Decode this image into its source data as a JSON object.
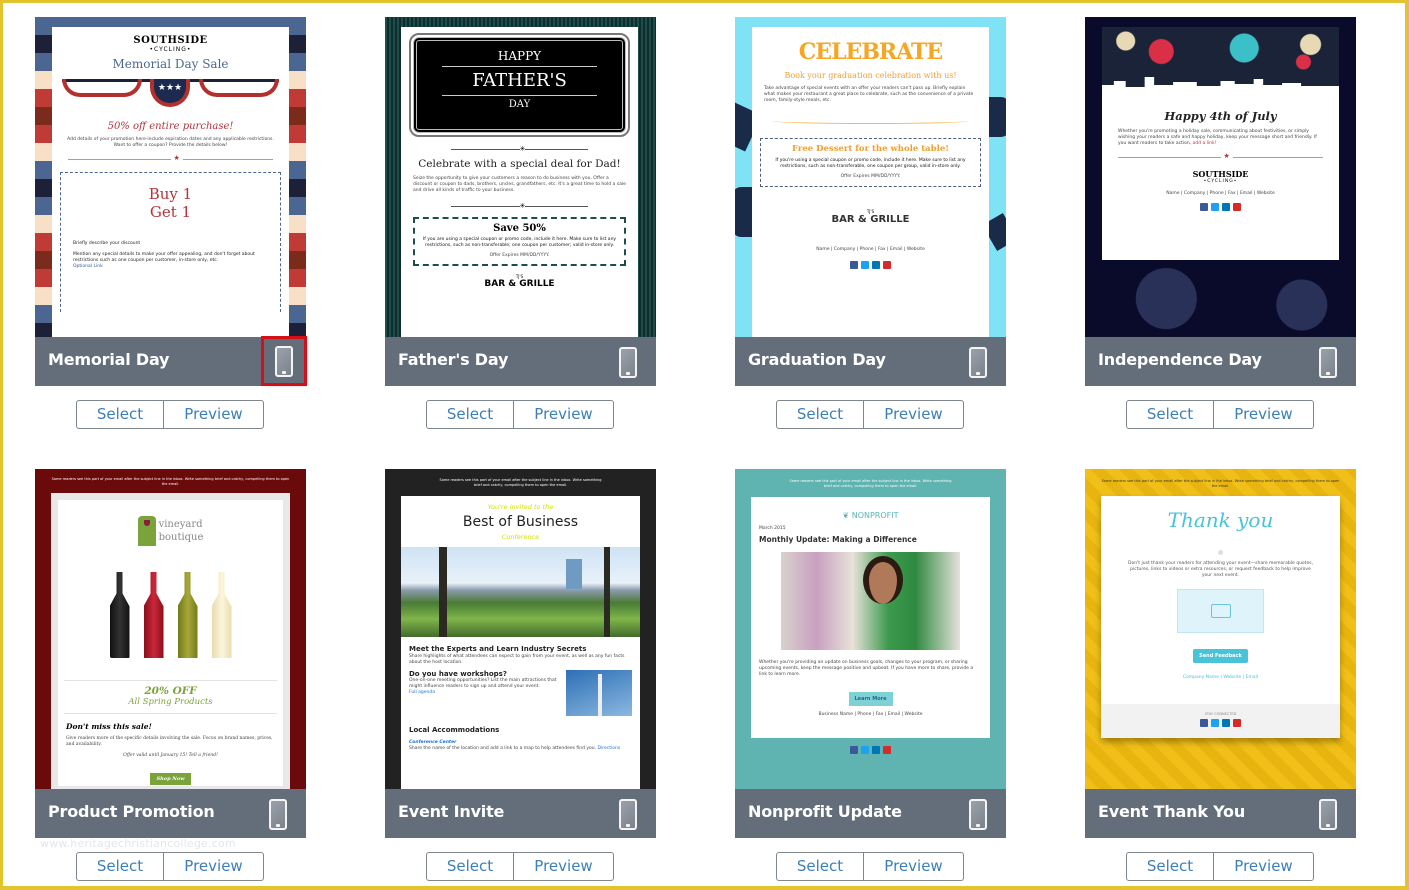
{
  "accent_colors": {
    "frame": "#e2c52e",
    "caption_bg": "#646e7a",
    "button_text": "#3d7fb9",
    "highlight": "#d40f17"
  },
  "templates": [
    {
      "title": "Memorial Day",
      "select_label": "Select",
      "preview_label": "Preview",
      "mobile_icon": "mobile-phone-icon",
      "mobile_highlighted": true,
      "preview": {
        "brand": "SOUTHSIDE",
        "brand_sub": "•CYCLING•",
        "heading": "Memorial Day Sale",
        "offer": "50% off entire purchase!",
        "body": "Add details of your promotion here-include expiration dates and any applicable restrictions. Want to offer a coupon? Provide the details below!",
        "coupon_line1": "Buy 1",
        "coupon_line2": "Get 1",
        "coupon_desc": "Briefly describe your discount",
        "coupon_body": "Mention any special details to make your offer appealing, and don't forget about restrictions such as one coupon per customer, in-store only, etc.",
        "coupon_link": "Optional Link"
      }
    },
    {
      "title": "Father's Day",
      "select_label": "Select",
      "preview_label": "Preview",
      "mobile_icon": "mobile-phone-icon",
      "mobile_highlighted": false,
      "preview": {
        "banner1": "HAPPY",
        "banner2": "FATHER'S",
        "banner3": "DAY",
        "heading": "Celebrate with a special deal for Dad!",
        "body": "Seize the opportunity to give your customers a reason to do business with you. Offer a discount or coupon to dads, brothers, uncles, grandfathers, etc. It's a great time to hold a sale and drive all kinds of traffic to your business.",
        "coupon_title": "Save 50%",
        "coupon_body": "If you are using a special coupon or promo code, include it here. Make sure to list any restrictions, such as non-transferable; one coupon per customer; valid in-store only.",
        "expires": "Offer Expires MM/DD/YYYY.",
        "logo": "BAR & GRILLE",
        "logo_top": "TJ'S"
      }
    },
    {
      "title": "Graduation Day",
      "select_label": "Select",
      "preview_label": "Preview",
      "mobile_icon": "mobile-phone-icon",
      "mobile_highlighted": false,
      "preview": {
        "banner": "CELEBRATE",
        "heading": "Book your graduation celebration with us!",
        "body": "Take advantage of special events with an offer your readers can't pass up. Briefly explain what makes your restaurant a great place to celebrate, such as the convenience of a private room, family-style meals, etc.",
        "coupon_title": "Free Dessert for the whole table!",
        "coupon_body": "If you're using a special coupon or promo code, include it here. Make sure to list any restrictions, such as non-transferable, one coupon per group, valid in-store only.",
        "expires": "Offer Expires MM/DD/YYYY.",
        "logo": "BAR & GRILLE",
        "logo_top": "TJ'S",
        "footer": "Name | Company | Phone | Fax | Email | Website"
      }
    },
    {
      "title": "Independence Day",
      "select_label": "Select",
      "preview_label": "Preview",
      "mobile_icon": "mobile-phone-icon",
      "mobile_highlighted": false,
      "preview": {
        "heading": "Happy 4th of July",
        "body": "Whether you're promoting a holiday sale, communicating about festivities, or simply wishing your readers a safe and happy holiday, keep your message short and friendly. If you want readers to take action,",
        "link": "add a link!",
        "brand": "SOUTHSIDE",
        "brand_sub": "•CYCLING•",
        "footer": "Name | Company | Phone | Fax | Email | Website"
      }
    },
    {
      "title": "Product Promotion",
      "select_label": "Select",
      "preview_label": "Preview",
      "mobile_icon": "mobile-phone-icon",
      "mobile_highlighted": false,
      "preview": {
        "preheader": "Some readers see this part of your email after the subject line in the inbox. Write something brief and catchy, compelling them to open the email.",
        "brand1": "vineyard",
        "brand2": "boutique",
        "offer": "20% OFF",
        "offer_sub": "All Spring Products",
        "heading": "Don't miss this sale!",
        "body": "Give readers more of the specific details involving the sale. Focus on brand names, prices, and availability.",
        "note": "Offer valid until January 15! Tell a friend!",
        "cta": "Shop Now"
      }
    },
    {
      "title": "Event Invite",
      "select_label": "Select",
      "preview_label": "Preview",
      "mobile_icon": "mobile-phone-icon",
      "mobile_highlighted": false,
      "preview": {
        "preheader": "Some readers see this part of your email after the subject line in the inbox. Write something brief and catchy, compelling them to open the email.",
        "kicker": "You're invited to the",
        "heading": "Best of Business",
        "sub": "Conference",
        "s1_title": "Meet the Experts and Learn Industry Secrets",
        "s1_body": "Share highlights of what attendees can expect to gain from your event, as well as any fun facts about the host location.",
        "s2_title": "Do you have workshops?",
        "s2_body": "One-on-one meeting opportunities? List the main attractions that might influence readers to sign up and attend your event.",
        "s2_link": "Full agenda",
        "s3_title": "Local Accommodations",
        "s3_link": "Conference Center",
        "s3_body": "Share the name of the location and add a link to a map to help attendees find you.",
        "s3_link2": "Directions"
      }
    },
    {
      "title": "Nonprofit Update",
      "select_label": "Select",
      "preview_label": "Preview",
      "mobile_icon": "mobile-phone-icon",
      "mobile_highlighted": false,
      "preview": {
        "preheader": "Some readers see this part of your email after the subject line in the inbox. Write something brief and catchy, compelling them to open the email.",
        "brand": "NONPROFIT",
        "date": "March 2015",
        "heading": "Monthly Update: Making a Difference",
        "body": "Whether you're providing an update on business goals, changes to your program, or sharing upcoming events, keep the message positive and upbeat. If you have more to share, provide a link to learn more.",
        "cta": "Learn More",
        "footer": "Business Name | Phone | Fax | Email | Website"
      }
    },
    {
      "title": "Event Thank You",
      "select_label": "Select",
      "preview_label": "Preview",
      "mobile_icon": "mobile-phone-icon",
      "mobile_highlighted": false,
      "preview": {
        "preheader": "Some readers see this part of your email after the subject line in the inbox. Write something brief and catchy, compelling them to open the email.",
        "heading": "Thank you",
        "body": "Don't just thank your readers for attending your event—share memorable quotes, pictures, links to videos or extra resources, or request feedback to help improve your next event.",
        "cta": "Send Feedback",
        "footer": "Company Name | Website | Email",
        "stay": "STAY CONNECTED"
      }
    }
  ],
  "watermark": "www.heritagechristiancollege.com"
}
